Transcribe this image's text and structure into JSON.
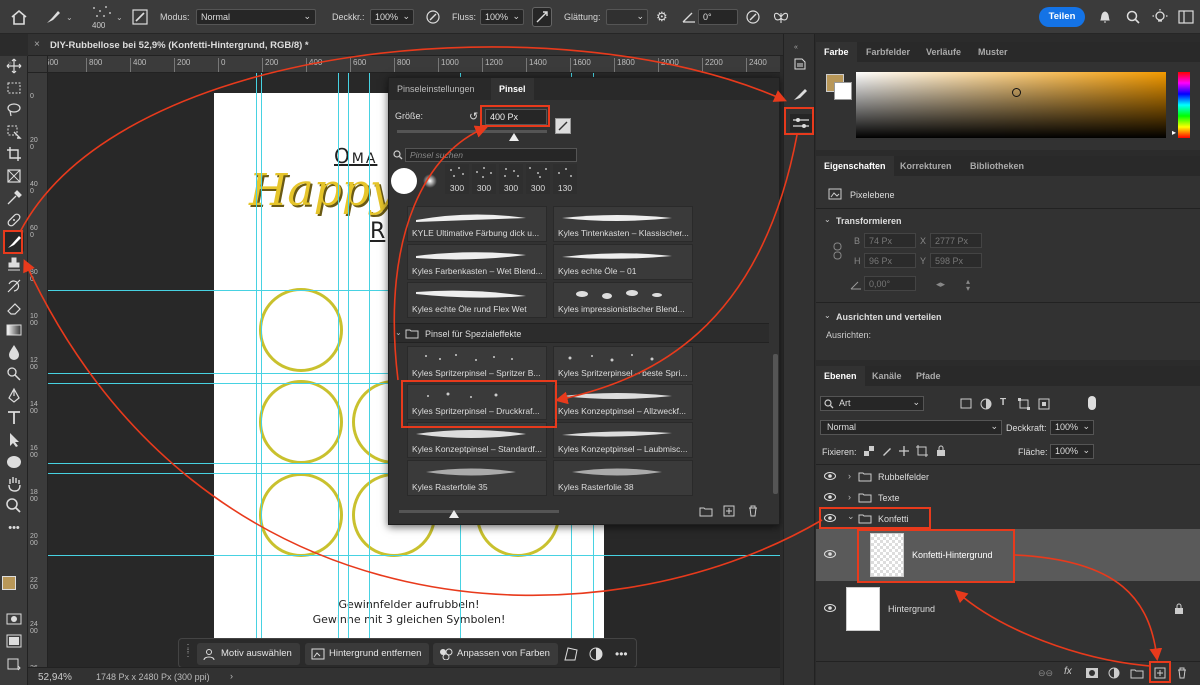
{
  "topbar": {
    "brush_size": "400",
    "mode_label": "Modus:",
    "mode_value": "Normal",
    "opacity_label": "Deckkr.:",
    "opacity_value": "100%",
    "flow_label": "Fluss:",
    "flow_value": "100%",
    "smoothing_label": "Glättung:",
    "angle_value": "0°",
    "share_label": "Teilen",
    "accent": "#1473e6"
  },
  "document": {
    "tab_title": "DIY-Rubbellose bei 52,9% (Konfetti-Hintergrund, RGB/8) *",
    "text_top": "Oma",
    "text_right": "R",
    "text_happy": "Happy",
    "footer_line1": "Gewinnfelder aufrubbeln!",
    "footer_line2": "Gewinne mit 3 gleichen Symbolen!"
  },
  "ruler": {
    "h": [
      "600",
      "800",
      "400",
      "200",
      "0",
      "200",
      "400",
      "600",
      "800",
      "1000",
      "1200",
      "1400",
      "1600",
      "1800",
      "2000",
      "2200",
      "2400",
      "2600"
    ],
    "v": [
      "0",
      "200",
      "400",
      "600",
      "800",
      "1000",
      "1200",
      "1400",
      "1600",
      "1800",
      "2000",
      "2200",
      "2400",
      "2600"
    ]
  },
  "brush_panel": {
    "tab_settings": "Pinseleinstellungen",
    "tab_brush": "Pinsel",
    "size_label": "Größe:",
    "size_value": "400 Px",
    "search_placeholder": "Pinsel suchen",
    "tips": [
      "300",
      "300",
      "300",
      "300",
      "130"
    ],
    "folder_label": "Pinsel für Spezialeffekte",
    "brushes_a": [
      "KYLE Ultimative Färbung dick u...",
      "Kyles Tintenkasten – Klassischer...",
      "Kyles Farbenkasten – Wet Blend...",
      "Kyles echte Öle – 01",
      "Kyles echte Öle rund Flex Wet",
      "Kyles impressionistischer Blend..."
    ],
    "brushes_b": [
      "Kyles Spritzerpinsel – Spritzer B...",
      "Kyles Spritzerpinsel – beste Spri...",
      "Kyles Spritzerpinsel – Druckkraf...",
      "Kyles Konzeptpinsel – Allzweckf...",
      "Kyles Konzeptpinsel – Standardf...",
      "Kyles Konzeptpinsel – Laubmisc...",
      "Kyles Rasterfolie 35",
      "Kyles Rasterfolie 38"
    ]
  },
  "color_panel": {
    "tabs": [
      "Farbe",
      "Farbfelder",
      "Verläufe",
      "Muster"
    ],
    "fg": "#b89758"
  },
  "properties": {
    "tabs": [
      "Eigenschaften",
      "Korrekturen",
      "Bibliotheken"
    ],
    "kind": "Pixelebene",
    "transform_label": "Transformieren",
    "w_label": "B",
    "w_value": "74 Px",
    "x_value": "2777 Px",
    "h_label": "H",
    "h_value": "96 Px",
    "y_value": "598 Px",
    "angle_value": "0,00°",
    "align_label": "Ausrichten und verteilen",
    "align_sub": "Ausrichten:"
  },
  "layers": {
    "tabs": [
      "Ebenen",
      "Kanäle",
      "Pfade"
    ],
    "filter": "Art",
    "blend": "Normal",
    "opacity_label": "Deckkraft:",
    "opacity_value": "100%",
    "lock_label": "Fixieren:",
    "fill_label": "Fläche:",
    "fill_value": "100%",
    "items": [
      {
        "name": "Rubbelfelder"
      },
      {
        "name": "Texte"
      },
      {
        "name": "Konfetti"
      },
      {
        "name": "Konfetti-Hintergrund"
      },
      {
        "name": "Hintergrund"
      }
    ]
  },
  "context_bar": {
    "select_subject": "Motiv auswählen",
    "remove_bg": "Hintergrund entfernen",
    "adjust_colors": "Anpassen von Farben"
  },
  "status": {
    "zoom": "52,94%",
    "info": "1748 Px x 2480 Px (300 ppi)"
  }
}
